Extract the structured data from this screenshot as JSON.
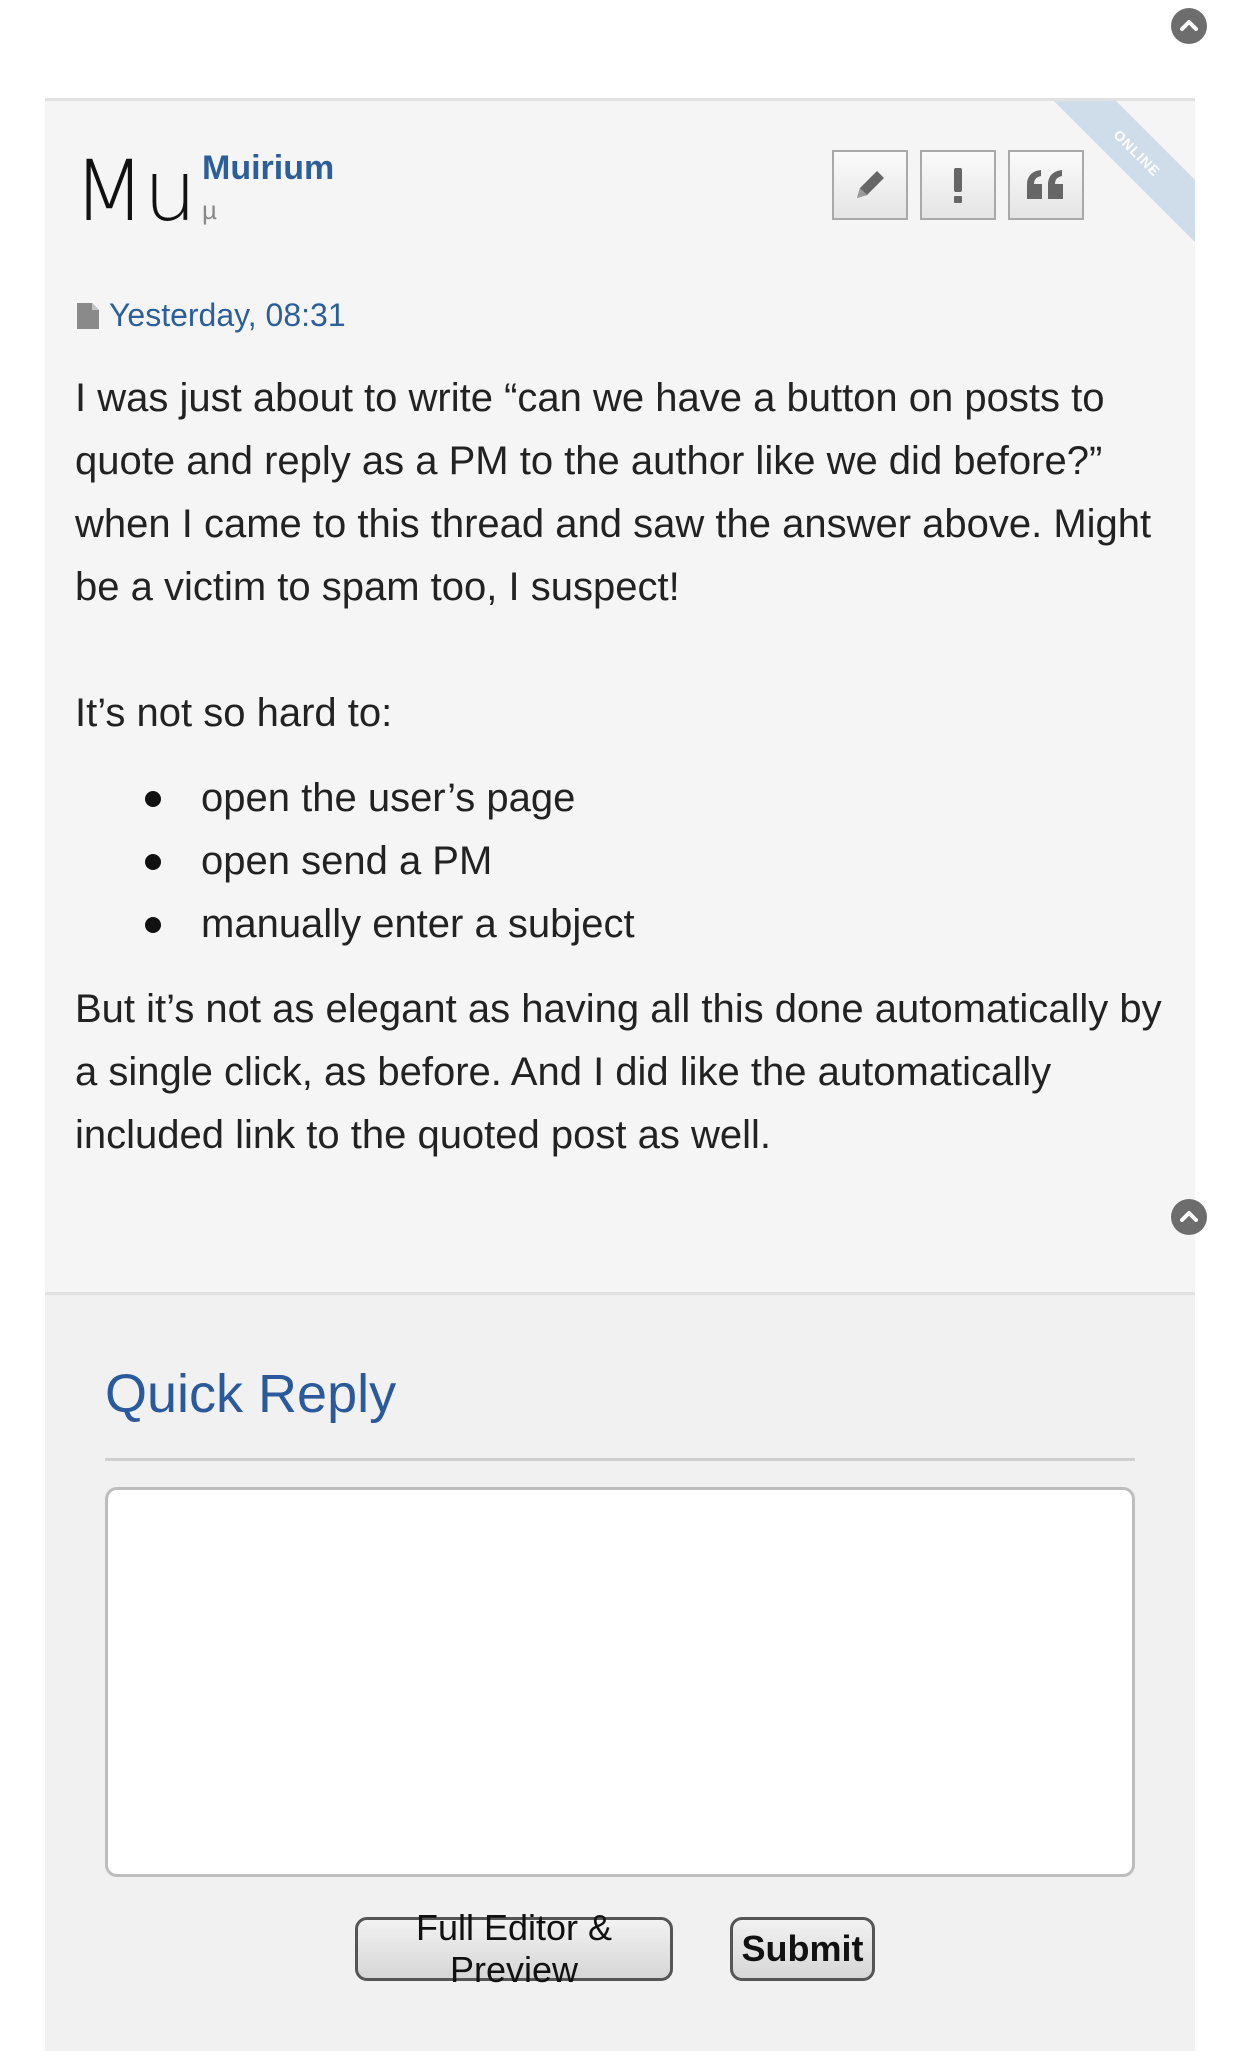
{
  "post": {
    "online_label": "ONLINE",
    "avatar_initials": "Mu",
    "username": "Muirium",
    "user_title": "µ",
    "date": "Yesterday, 08:31",
    "actions": [
      {
        "name": "edit-button",
        "icon": "pencil-icon"
      },
      {
        "name": "report-button",
        "icon": "exclamation-icon"
      },
      {
        "name": "quote-button",
        "icon": "quote-icon"
      }
    ],
    "body": {
      "paragraph_1": "I was just about to write “can we have a button on posts to quote and reply as a PM to the author like we did before?” when I came to this thread and saw the answer above. Might be a victim to spam too, I suspect!",
      "paragraph_2": "It’s not so hard to:",
      "list": [
        "open the user’s page",
        "open send a PM",
        "manually enter a subject"
      ],
      "paragraph_3": "But it’s not as elegant as having all this done automatically by a single click, as before. And I did like the automatically included link to the quoted post as well."
    }
  },
  "quick_reply": {
    "title": "Quick Reply",
    "textarea_value": "",
    "full_editor_label": "Full Editor & Preview",
    "submit_label": "Submit"
  },
  "colors": {
    "link_blue": "#2c5f9a",
    "post_bg": "#f5f5f5",
    "ribbon": "#cfdcea"
  }
}
